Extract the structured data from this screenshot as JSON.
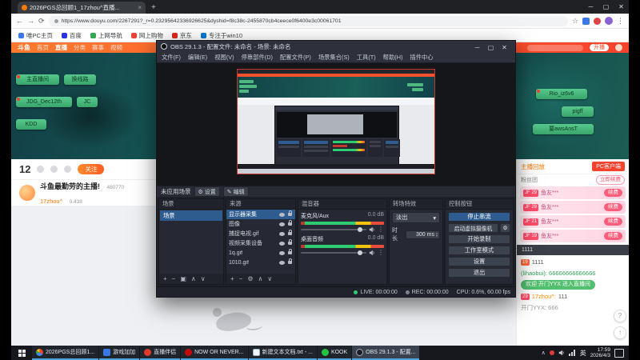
{
  "icons": {
    "back": "←",
    "forward": "→",
    "reload": "⟳",
    "star": "☆",
    "dots": "⋮",
    "close": "×",
    "minimize": "─",
    "maximize": "▢",
    "x": "✕",
    "newtab": "+",
    "plus": "+",
    "minus": "−",
    "up": "∧",
    "down": "∨",
    "grid": "▣",
    "gear": "⚙",
    "pencil": "✎",
    "caret": "▾",
    "spin_up": "▴",
    "spin_down": "▾",
    "chevron_up": "∧",
    "help": "?",
    "arrow_up": "↑"
  },
  "browser": {
    "tab_title": "2026PGS总回顾1_17zhou^直播...",
    "url": "https://www.douyu.com/2267291?_r=0.23295642336926625&dyshid=f8c38c-2455870cb4ceece0f6400e3c00061701",
    "bookmarks": [
      {
        "label": "唯PC主页"
      },
      {
        "label": "百度"
      },
      {
        "label": "上网导航"
      },
      {
        "label": "网上购物"
      },
      {
        "label": "京东"
      },
      {
        "label": "专注于win10"
      }
    ]
  },
  "douyu": {
    "logo": "斗鱼",
    "nav": [
      "首页",
      "直播",
      "分类",
      "赛事",
      "视频"
    ],
    "header_button": "开播",
    "left_pills": [
      "主直播间",
      "换线路",
      "JDG_Dec12th",
      "JC",
      "KDD"
    ],
    "right_pills": [
      "Rio_iz6v6",
      "pigff",
      "要awsAnsT"
    ],
    "stats_value": "12",
    "follow_button": "关注",
    "room_title": "斗鱼最勤劳的主播!",
    "room_id": "480770",
    "streamer_name": "17zhou^",
    "streamer_meta": "0.438",
    "right_panel": {
      "replay_link": "主播回放",
      "pc_client_button": "PC客户端",
      "fan_header": "粉丝团",
      "renew_button": "立即续费",
      "fan_rows": [
        {
          "badge": "JF 29",
          "name": "鱼友***",
          "action": "续费"
        },
        {
          "badge": "JF 29",
          "name": "鱼友***",
          "action": "续费"
        },
        {
          "badge": "JF 21",
          "name": "鱼友***",
          "action": "续费"
        },
        {
          "badge": "JF 19",
          "name": "鱼友***",
          "action": "续费"
        }
      ],
      "notice_bar": "1111",
      "chat": [
        {
          "badge": "19",
          "text": "1111"
        },
        {
          "text": "(lihaobui): 66666666666666"
        },
        {
          "text": "欢迎 开门YYX 进入直播间"
        },
        {
          "badge": "29",
          "user": "17zhou^:",
          "text": "111"
        },
        {
          "text": "开门YYX: 666"
        }
      ]
    }
  },
  "obs": {
    "title": "OBS 29.1.3 - 配置文件: 未命名 - 场景: 未命名",
    "menu": [
      "文件(F)",
      "编辑(E)",
      "视图(V)",
      "停靠部件(D)",
      "配置文件(P)",
      "场景集合(S)",
      "工具(T)",
      "帮助(H)",
      "插件中心"
    ],
    "alert_text": "未应用场景",
    "alert_settings": "设置",
    "alert_edit": "编辑",
    "docks": {
      "scenes": {
        "title": "场景",
        "items": [
          "场景"
        ]
      },
      "sources": {
        "title": "来源",
        "items": [
          "显示器采集",
          "图像",
          "捕捉电视.gif",
          "视频采集设备",
          "1q.gif",
          "1010.gif"
        ]
      },
      "mixer": {
        "title": "混音器",
        "channels": [
          {
            "name": "麦克风/Aux",
            "db": "0.0 dB"
          },
          {
            "name": "桌面音频",
            "db": "0.0 dB"
          }
        ]
      },
      "transitions": {
        "title": "转场特效",
        "selected": "淡出",
        "duration_label": "时长",
        "duration_value": "300 ms"
      },
      "controls": {
        "title": "控制按钮",
        "buttons": [
          "停止串流",
          "启动虚拟摄像机",
          "开始录制",
          "工作室模式",
          "设置",
          "退出"
        ]
      }
    },
    "status": {
      "live": "LIVE: 00:00:00",
      "rec": "REC: 00:00:00",
      "stats": "CPU: 0.6%, 60.00 fps"
    }
  },
  "taskbar": {
    "items": [
      {
        "label": "2026PGS总回顾1..."
      },
      {
        "label": "游戏加加"
      },
      {
        "label": "直播伴侣"
      },
      {
        "label": "NOW OR NEVER..."
      },
      {
        "label": "新建文本文档.txt - ..."
      },
      {
        "label": "KOOK"
      },
      {
        "label": "OBS 29.1.3 - 配置..."
      }
    ],
    "tray": {
      "ime": "英",
      "time": "17:59",
      "date": "2026/4/3"
    }
  }
}
